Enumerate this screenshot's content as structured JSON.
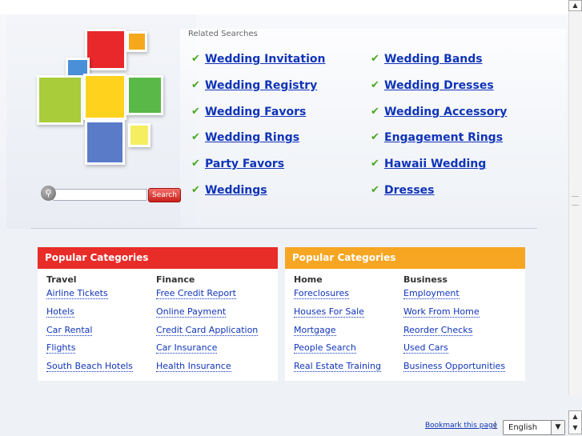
{
  "related_searches": {
    "title": "Related Searches",
    "left": [
      "Wedding Invitation",
      "Wedding Registry",
      "Wedding Favors",
      "Wedding Rings",
      "Party Favors",
      "Weddings"
    ],
    "right": [
      "Wedding Bands",
      "Wedding Dresses",
      "Wedding Accessory",
      "Engagement Rings",
      "Hawaii Wedding",
      "Dresses"
    ]
  },
  "search": {
    "button_label": "Search",
    "value": ""
  },
  "categories": [
    {
      "heading": "Popular Categories",
      "color": "#e82c28",
      "columns": [
        {
          "title": "Travel",
          "links": [
            "Airline Tickets",
            "Hotels",
            "Car Rental",
            "Flights",
            "South Beach Hotels"
          ]
        },
        {
          "title": "Finance",
          "links": [
            "Free Credit Report",
            "Online Payment",
            "Credit Card Application",
            "Car Insurance",
            "Health Insurance"
          ]
        }
      ]
    },
    {
      "heading": "Popular Categories",
      "color": "#f6a623",
      "columns": [
        {
          "title": "Home",
          "links": [
            "Foreclosures",
            "Houses For Sale",
            "Mortgage",
            "People Search",
            "Real Estate Training"
          ]
        },
        {
          "title": "Business",
          "links": [
            "Employment",
            "Work From Home",
            "Reorder Checks",
            "Used Cars",
            "Business Opportunities"
          ]
        }
      ]
    }
  ],
  "footer": {
    "bookmark_label": "Bookmark this page",
    "separator": "|",
    "language": "English"
  },
  "icons": {
    "check": "check-icon",
    "search": "magnifier-icon"
  }
}
